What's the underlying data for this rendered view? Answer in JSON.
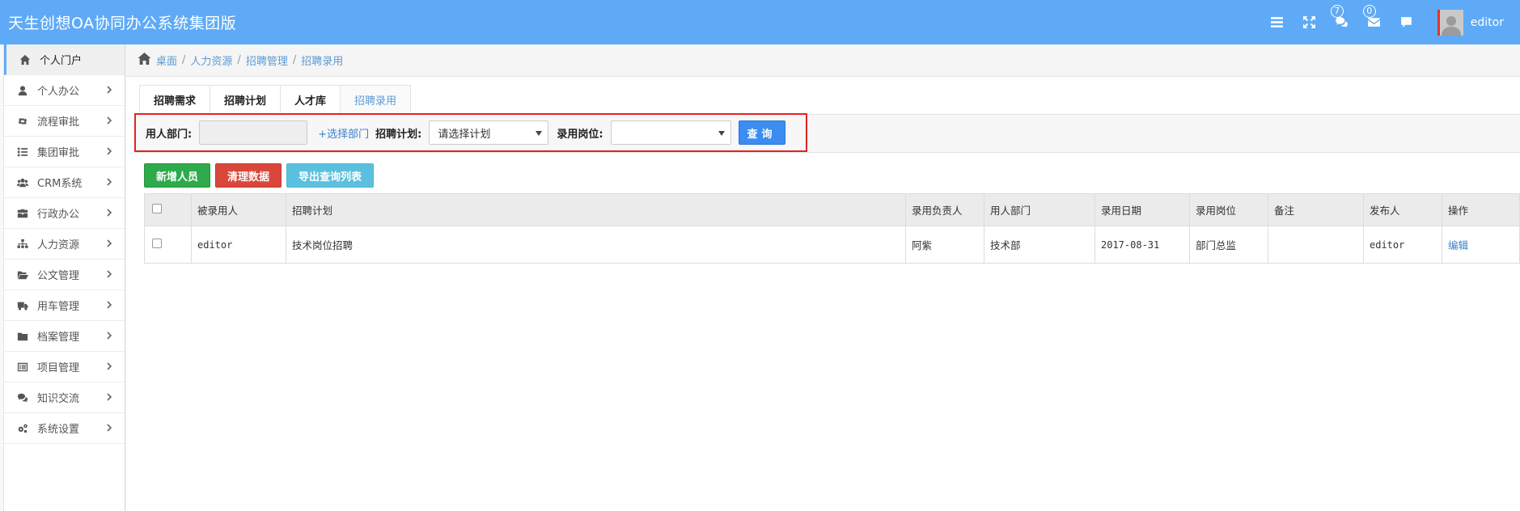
{
  "header": {
    "app_title": "天生创想OA协同办公系统集团版",
    "icons": [
      "menu-icon",
      "fullscreen-icon",
      "comments-icon",
      "envelope-icon",
      "chat-icon"
    ],
    "comments_badge": "7",
    "mail_badge": "0",
    "username": "editor"
  },
  "sidebar": {
    "items": [
      {
        "label": "个人门户",
        "icon": "home-icon"
      },
      {
        "label": "个人办公",
        "icon": "user-icon"
      },
      {
        "label": "流程审批",
        "icon": "retweet-icon"
      },
      {
        "label": "集团审批",
        "icon": "list-icon"
      },
      {
        "label": "CRM系统",
        "icon": "users-icon"
      },
      {
        "label": "行政办公",
        "icon": "briefcase-icon"
      },
      {
        "label": "人力资源",
        "icon": "sitemap-icon"
      },
      {
        "label": "公文管理",
        "icon": "folder-open-icon"
      },
      {
        "label": "用车管理",
        "icon": "truck-icon"
      },
      {
        "label": "档案管理",
        "icon": "folder-icon"
      },
      {
        "label": "项目管理",
        "icon": "list-alt-icon"
      },
      {
        "label": "知识交流",
        "icon": "comments-icon"
      },
      {
        "label": "系统设置",
        "icon": "cogs-icon"
      }
    ]
  },
  "breadcrumb": {
    "items": [
      "桌面",
      "人力资源",
      "招聘管理",
      "招聘录用"
    ],
    "separator": "/"
  },
  "tabs": [
    {
      "label": "招聘需求"
    },
    {
      "label": "招聘计划"
    },
    {
      "label": "人才库"
    },
    {
      "label": "招聘录用",
      "active": true
    }
  ],
  "filter": {
    "dept_label": "用人部门:",
    "dept_value": "",
    "select_dept_link": "+选择部门",
    "plan_label": "招聘计划:",
    "plan_value": "请选择计划",
    "position_label": "录用岗位:",
    "position_value": "",
    "query_button": "查询"
  },
  "actions": {
    "add_label": "新增人员",
    "clear_label": "清理数据",
    "export_label": "导出查询列表"
  },
  "table": {
    "headers": [
      "被录用人",
      "招聘计划",
      "录用负责人",
      "用人部门",
      "录用日期",
      "录用岗位",
      "备注",
      "发布人",
      "操作"
    ],
    "rows": [
      {
        "hired": "editor",
        "plan": "技术岗位招聘",
        "manager": "阿紫",
        "dept": "技术部",
        "date": "2017-08-31",
        "position": "部门总监",
        "note": "",
        "publisher": "editor",
        "action": "编辑"
      }
    ]
  },
  "colors": {
    "header_bg": "#5faaf6",
    "link": "#3a7fc8",
    "query_button": "#3b8df2",
    "add_button": "#2eaa4a",
    "clear_button": "#d9473a",
    "export_button": "#5bc0de",
    "highlight_border": "#e02424"
  }
}
